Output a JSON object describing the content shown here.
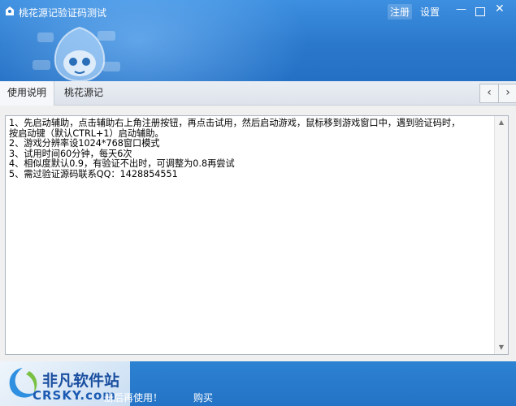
{
  "window": {
    "title": "桃花源记验证码测试",
    "register_label": "注册",
    "settings_label": "设置",
    "minimize_symbol": "—",
    "close_symbol": "✕"
  },
  "tabs": [
    {
      "label": "使用说明",
      "active": true
    },
    {
      "label": "桃花源记",
      "active": false
    }
  ],
  "nav": {
    "prev": "‹",
    "next": "›"
  },
  "instructions": "1、先启动辅助，点击辅助右上角注册按钮，再点击试用，然后启动游戏，鼠标移到游戏窗口中，遇到验证码时，\n按启动键（默认CTRL+1）启动辅助。\n2、游戏分辨率设1024*768窗口模式\n3、试用时间60分钟，每天6次\n4、相似度默认0.9，有验证不出时，可调整为0.8再尝试\n5、需过验证源码联系QQ：1428854551",
  "footer": {
    "message": "册后再使用！",
    "buy_link": "购买",
    "logo_text": "非凡软件站",
    "logo_sub": "CRSKY.com"
  },
  "colors": {
    "header": "#2a78cc",
    "footer": "#2473c6",
    "content_bg": "#f0f0f0"
  }
}
